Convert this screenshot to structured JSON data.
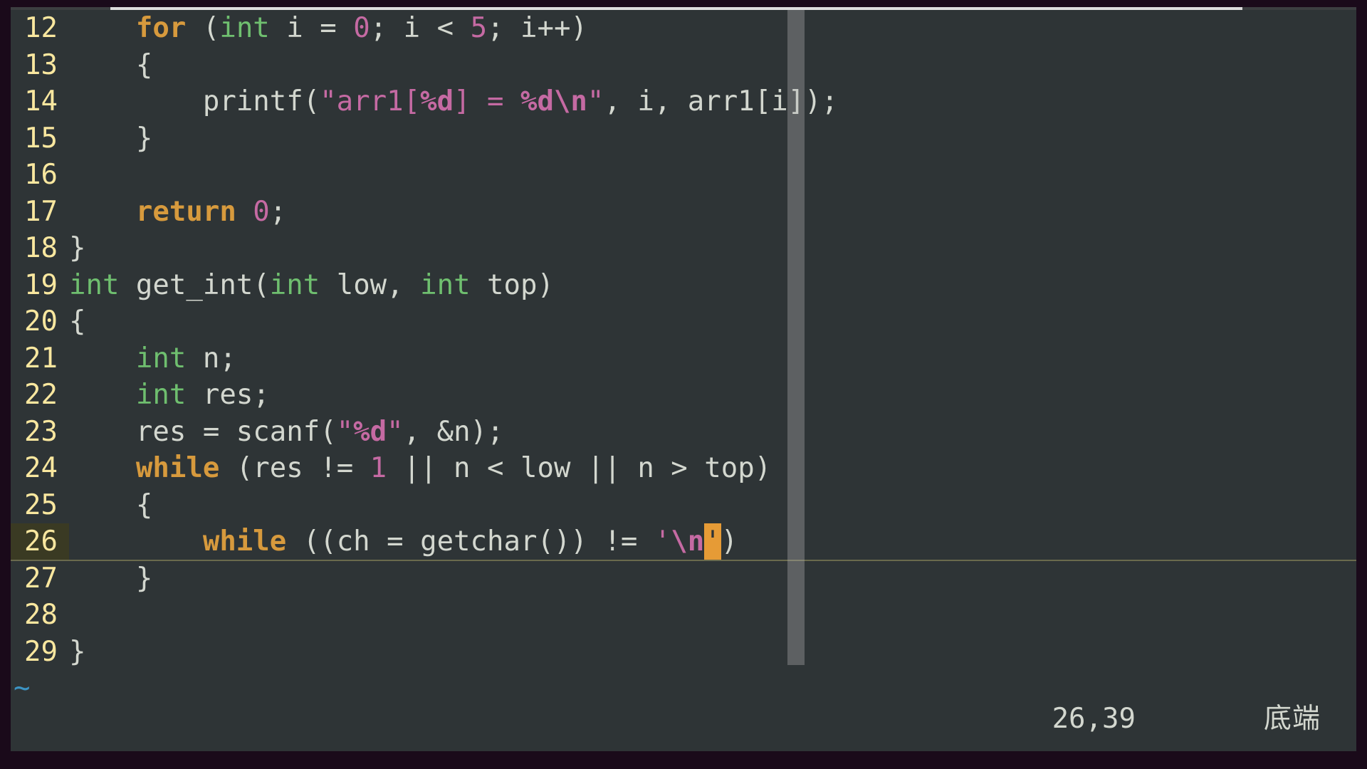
{
  "editor": {
    "first_line_number": 12,
    "cursor": {
      "line": 26,
      "col": 39
    },
    "status": {
      "position": "26,39",
      "scroll_label": "底端"
    },
    "ruler_column": 42,
    "lines": [
      {
        "n": 12,
        "tokens": [
          {
            "t": "    ",
            "c": "c-ident"
          },
          {
            "t": "for",
            "c": "c-key"
          },
          {
            "t": " (",
            "c": "c-punct"
          },
          {
            "t": "int",
            "c": "c-type"
          },
          {
            "t": " i = ",
            "c": "c-ident"
          },
          {
            "t": "0",
            "c": "c-num"
          },
          {
            "t": "; i < ",
            "c": "c-ident"
          },
          {
            "t": "5",
            "c": "c-num"
          },
          {
            "t": "; i++)",
            "c": "c-ident"
          }
        ]
      },
      {
        "n": 13,
        "tokens": [
          {
            "t": "    {",
            "c": "c-ident"
          }
        ]
      },
      {
        "n": 14,
        "tokens": [
          {
            "t": "        printf(",
            "c": "c-ident"
          },
          {
            "t": "\"arr1[",
            "c": "c-str"
          },
          {
            "t": "%d",
            "c": "c-esc"
          },
          {
            "t": "] = ",
            "c": "c-str"
          },
          {
            "t": "%d",
            "c": "c-esc"
          },
          {
            "t": "\\n",
            "c": "c-esc"
          },
          {
            "t": "\"",
            "c": "c-str"
          },
          {
            "t": ", i, arr1[i]);",
            "c": "c-ident"
          }
        ]
      },
      {
        "n": 15,
        "tokens": [
          {
            "t": "    }",
            "c": "c-ident"
          }
        ]
      },
      {
        "n": 16,
        "tokens": [
          {
            "t": "",
            "c": "c-ident"
          }
        ]
      },
      {
        "n": 17,
        "tokens": [
          {
            "t": "    ",
            "c": "c-ident"
          },
          {
            "t": "return",
            "c": "c-key"
          },
          {
            "t": " ",
            "c": "c-ident"
          },
          {
            "t": "0",
            "c": "c-num"
          },
          {
            "t": ";",
            "c": "c-ident"
          }
        ]
      },
      {
        "n": 18,
        "tokens": [
          {
            "t": "}",
            "c": "c-ident"
          }
        ]
      },
      {
        "n": 19,
        "tokens": [
          {
            "t": "int",
            "c": "c-type"
          },
          {
            "t": " get_int(",
            "c": "c-ident"
          },
          {
            "t": "int",
            "c": "c-type"
          },
          {
            "t": " low, ",
            "c": "c-ident"
          },
          {
            "t": "int",
            "c": "c-type"
          },
          {
            "t": " top)",
            "c": "c-ident"
          }
        ]
      },
      {
        "n": 20,
        "tokens": [
          {
            "t": "{",
            "c": "c-ident"
          }
        ]
      },
      {
        "n": 21,
        "tokens": [
          {
            "t": "    ",
            "c": "c-ident"
          },
          {
            "t": "int",
            "c": "c-type"
          },
          {
            "t": " n;",
            "c": "c-ident"
          }
        ]
      },
      {
        "n": 22,
        "tokens": [
          {
            "t": "    ",
            "c": "c-ident"
          },
          {
            "t": "int",
            "c": "c-type"
          },
          {
            "t": " res;",
            "c": "c-ident"
          }
        ]
      },
      {
        "n": 23,
        "tokens": [
          {
            "t": "    res = scanf(",
            "c": "c-ident"
          },
          {
            "t": "\"",
            "c": "c-str"
          },
          {
            "t": "%d",
            "c": "c-esc"
          },
          {
            "t": "\"",
            "c": "c-str"
          },
          {
            "t": ", &n);",
            "c": "c-ident"
          }
        ]
      },
      {
        "n": 24,
        "tokens": [
          {
            "t": "    ",
            "c": "c-ident"
          },
          {
            "t": "while",
            "c": "c-key"
          },
          {
            "t": " (res != ",
            "c": "c-ident"
          },
          {
            "t": "1",
            "c": "c-num"
          },
          {
            "t": " || n < low || n > top)",
            "c": "c-ident"
          }
        ]
      },
      {
        "n": 25,
        "tokens": [
          {
            "t": "    {",
            "c": "c-ident"
          }
        ]
      },
      {
        "n": 26,
        "current": true,
        "tokens": [
          {
            "t": "        ",
            "c": "c-ident"
          },
          {
            "t": "while",
            "c": "c-key"
          },
          {
            "t": " ((ch = getchar()) != ",
            "c": "c-ident"
          },
          {
            "t": "'",
            "c": "c-str"
          },
          {
            "t": "\\n",
            "c": "c-esc"
          },
          {
            "t": "'",
            "c": "c-str",
            "cursor": true
          },
          {
            "t": ")",
            "c": "c-ident"
          }
        ]
      },
      {
        "n": 27,
        "tokens": [
          {
            "t": "    }",
            "c": "c-ident"
          }
        ]
      },
      {
        "n": 28,
        "tokens": [
          {
            "t": "",
            "c": "c-ident"
          }
        ]
      },
      {
        "n": 29,
        "tokens": [
          {
            "t": "}",
            "c": "c-ident"
          }
        ]
      }
    ],
    "tilde": "~"
  }
}
